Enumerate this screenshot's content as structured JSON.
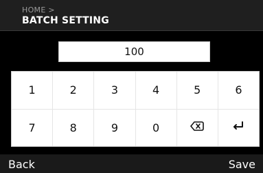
{
  "header": {
    "breadcrumb": "HOME >",
    "title": "BATCH SETTING"
  },
  "input": {
    "value": "100"
  },
  "keypad": {
    "row1": [
      "1",
      "2",
      "3",
      "4",
      "5",
      "6"
    ],
    "row2": [
      "7",
      "8",
      "9",
      "0"
    ],
    "backspace_icon": "backspace-icon",
    "enter_icon": "enter-icon"
  },
  "footer": {
    "back_label": "Back",
    "save_label": "Save"
  },
  "colors": {
    "header_bg": "#1f1f1f",
    "panel_bg": "#000000",
    "key_bg": "#ffffff",
    "key_text": "#111111"
  }
}
